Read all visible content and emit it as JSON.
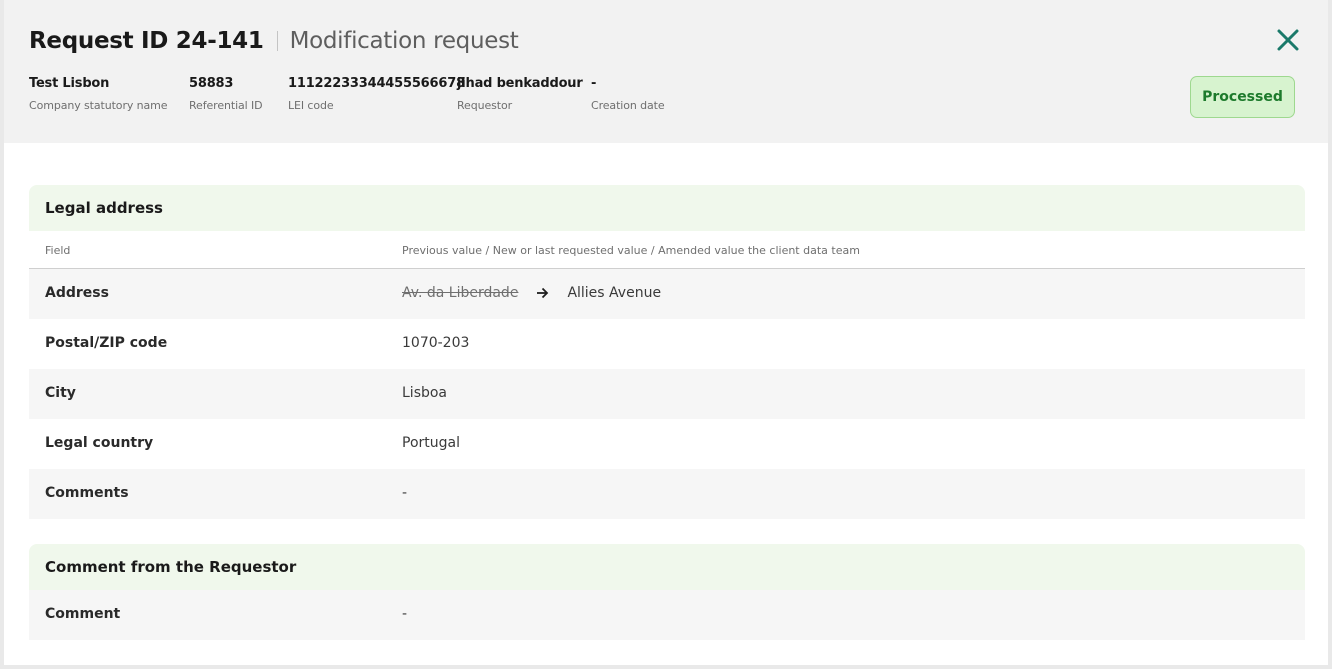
{
  "header": {
    "title": "Request ID 24-141",
    "subtitle": "Modification request",
    "status": "Processed",
    "close_icon": "close-icon",
    "accent_color": "#1b7a6a"
  },
  "meta": [
    {
      "value": "Test Lisbon",
      "label": "Company statutory name"
    },
    {
      "value": "58883",
      "label": "Referential ID"
    },
    {
      "value": "11122233344455566678",
      "label": "LEI code"
    },
    {
      "value": "jihad benkaddour",
      "label": "Requestor"
    },
    {
      "value": "-",
      "label": "Creation date"
    }
  ],
  "legal_address": {
    "title": "Legal address",
    "columns": [
      "Field",
      "Previous value / New or last requested value / Amended value the client data team"
    ],
    "rows": [
      {
        "field": "Address",
        "previous": "Av. da Liberdade",
        "value": "Allies Avenue"
      },
      {
        "field": "Postal/ZIP code",
        "value": "1070-203"
      },
      {
        "field": "City",
        "value": "Lisboa"
      },
      {
        "field": "Legal country",
        "value": "Portugal"
      },
      {
        "field": "Comments",
        "value": "-"
      }
    ]
  },
  "requestor_comment": {
    "title": "Comment from the Requestor",
    "rows": [
      {
        "field": "Comment",
        "value": "-"
      }
    ]
  }
}
